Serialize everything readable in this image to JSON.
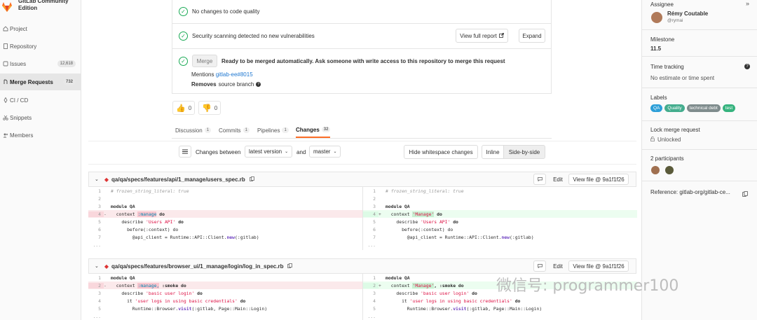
{
  "sidebar": {
    "brand": "GitLab Community Edition",
    "items": [
      {
        "label": "Project",
        "icon": "home-icon"
      },
      {
        "label": "Repository",
        "icon": "doc-icon"
      },
      {
        "label": "Issues",
        "icon": "issues-icon",
        "badge": "12,618"
      },
      {
        "label": "Merge Requests",
        "icon": "merge-request-icon",
        "badge": "732"
      },
      {
        "label": "CI / CD",
        "icon": "rocket-icon"
      },
      {
        "label": "Snippets",
        "icon": "scissors-icon"
      },
      {
        "label": "Members",
        "icon": "users-icon"
      }
    ]
  },
  "widget": {
    "code_quality": "No changes to code quality",
    "security": "Security scanning detected no new vulnerabilities",
    "view_report": "View full report",
    "expand": "Expand",
    "merge_btn": "Merge",
    "merge_status": "Ready to be merged automatically. Ask someone with write access to this repository to merge this request",
    "mentions_label": "Mentions",
    "mentions_link": "gitlab-ee#8015",
    "removes_label": "Removes",
    "removes_text": "source branch"
  },
  "emoji": {
    "thumbsup_count": "0",
    "thumbsdown_count": "0"
  },
  "tabs": [
    {
      "label": "Discussion",
      "count": "1"
    },
    {
      "label": "Commits",
      "count": "1"
    },
    {
      "label": "Pipelines",
      "count": "1"
    },
    {
      "label": "Changes",
      "count": "32"
    }
  ],
  "diff_toolbar": {
    "changes_between": "Changes between",
    "version_select": "latest version",
    "and": "and",
    "target_select": "master",
    "hide_whitespace": "Hide whitespace changes",
    "inline": "Inline",
    "side_by_side": "Side-by-side"
  },
  "files": [
    {
      "path": "qa/qa/specs/features/api/1_manage/users_spec.rb",
      "edit": "Edit",
      "view_file": "View file @ 9a1f1f26"
    },
    {
      "path": "qa/qa/specs/features/browser_ui/1_manage/login/log_in_spec.rb",
      "edit": "Edit",
      "view_file": "View file @ 9a1f1f26"
    }
  ],
  "diff1": {
    "l1": "# frozen_string_literal: true",
    "l3": "module QA",
    "l4_old_pre": "  context ",
    "l4_old_hl": ":manage",
    "l4_old_post": " do",
    "l4_new_pre": "  context ",
    "l4_new_hl": "'Manage'",
    "l4_new_post": " do",
    "l5_pre": "    describe ",
    "l5_str": "'Users API'",
    "l5_post": " do",
    "l6": "      before(:context) do",
    "l7_pre": "        @api_client = Runtime::API::Client.",
    "l7_mtd": "new",
    "l7_post": "(:gitlab)",
    "n1": "1",
    "n2": "2",
    "n3": "3",
    "n4": "4",
    "n5": "5",
    "n6": "6",
    "n7": "7",
    "minus": "-",
    "plus": "+",
    "ellipsis": "..."
  },
  "diff2": {
    "l1": "module QA",
    "l2_old_pre": "  context ",
    "l2_old_hl": ":manage,",
    "l2_old_post": " :smoke do",
    "l2_new_pre": "  context ",
    "l2_new_hl": "'Manage'",
    "l2_new_post": ", :smoke do",
    "l3_pre": "    describe ",
    "l3_str": "'basic user login'",
    "l3_post": " do",
    "l4_pre": "      it ",
    "l4_str": "'user logs in using basic credentials'",
    "l4_post": " do",
    "l5_pre": "        Runtime::Browser.",
    "l5_mtd": "visit",
    "l5_post": "(:gitlab, Page::Main::Login)"
  },
  "right_sidebar": {
    "assignee_label": "Assignee",
    "assignee_name": "Rémy Coutable",
    "assignee_handle": "@rymai",
    "milestone_label": "Milestone",
    "milestone_value": "11.5",
    "time_label": "Time tracking",
    "time_value": "No estimate or time spent",
    "labels_label": "Labels",
    "labels": [
      {
        "text": "QA",
        "color": "#2d9fd8"
      },
      {
        "text": "Quality",
        "color": "#44ad8e"
      },
      {
        "text": "technical debt",
        "color": "#7f8c8d"
      },
      {
        "text": "test",
        "color": "#36b37e"
      }
    ],
    "lock_label": "Lock merge request",
    "lock_value": "Unlocked",
    "participants_label": "2 participants",
    "reference": "Reference: gitlab-org/gitlab-ce..."
  },
  "watermark": "微信号: programmer100"
}
